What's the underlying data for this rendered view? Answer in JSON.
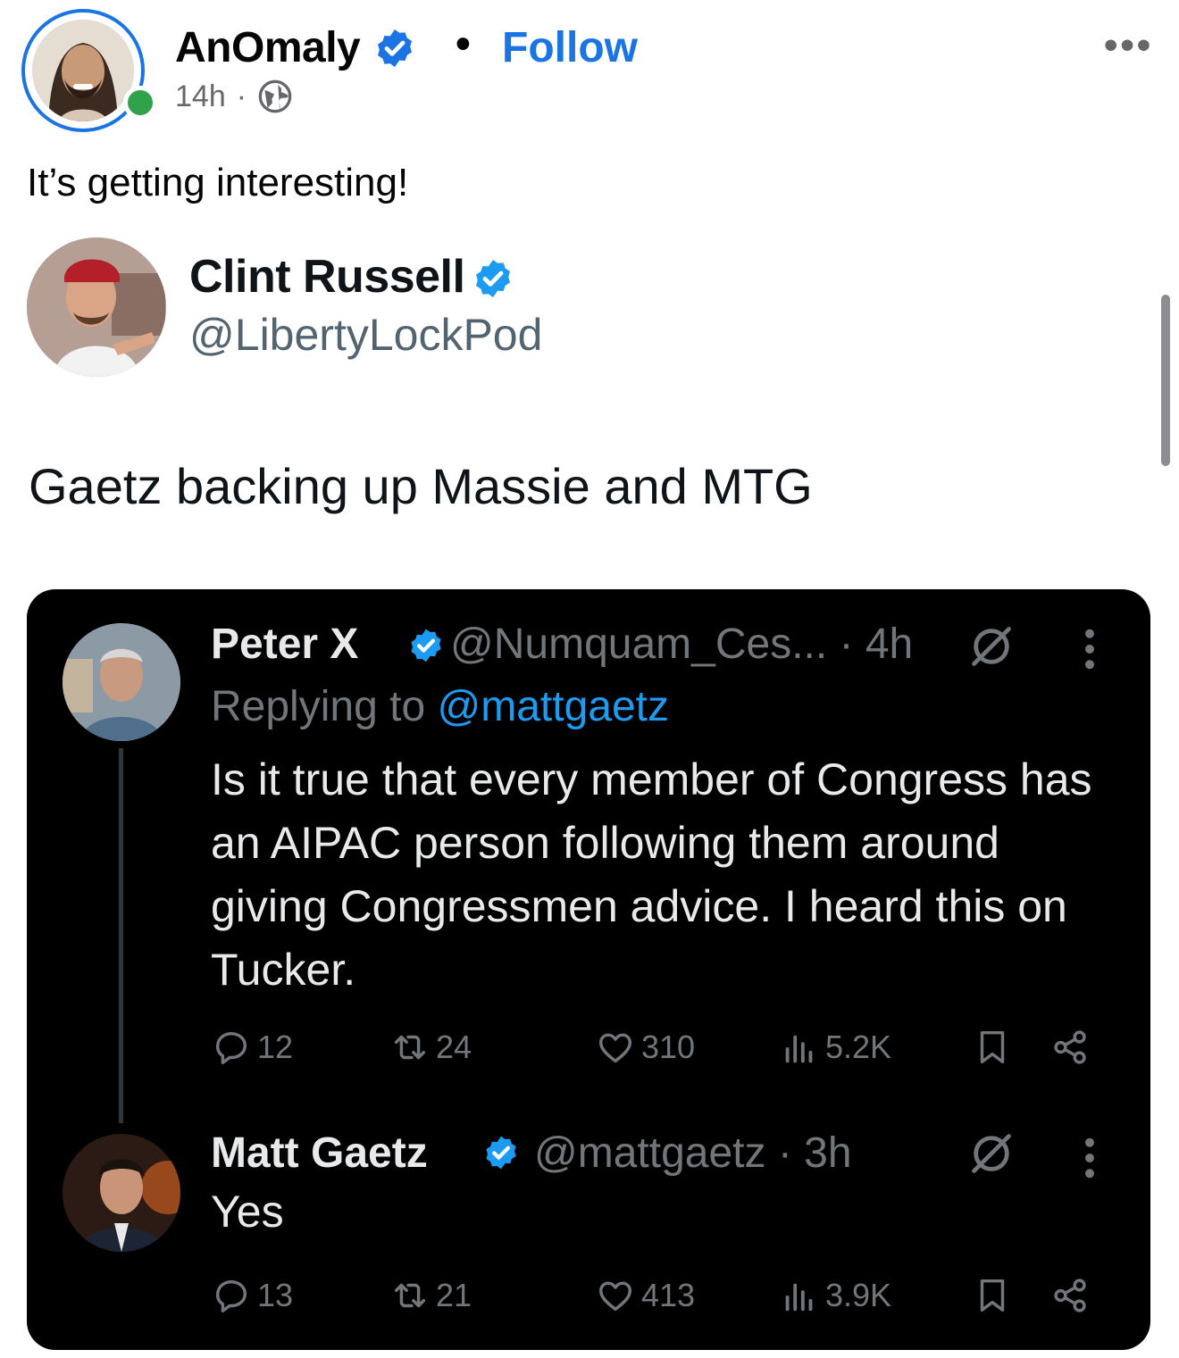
{
  "post": {
    "author_name": "AnOmaly",
    "follow_label": "Follow",
    "separator": "•",
    "more_label": "•••",
    "time": "14h",
    "meta_dot": "·",
    "text": "It’s getting interesting!"
  },
  "shared_tweet": {
    "name": "Clint Russell",
    "handle": "@LibertyLockPod",
    "text": "Gaetz backing up Massie and MTG"
  },
  "thread": {
    "reply": {
      "name": "Peter X",
      "handle_time": "@Numquam_Ces... · 4h",
      "replying_prefix": "Replying to ",
      "replying_mention": "@mattgaetz",
      "text": "Is it true that every member of Congress has an AIPAC person following them around giving Congressmen advice. I heard this on Tucker.",
      "replies": "12",
      "reposts": "24",
      "likes": "310",
      "views": "5.2K"
    },
    "answer": {
      "name": "Matt Gaetz",
      "handle_time": "@mattgaetz · 3h",
      "text": "Yes",
      "replies": "13",
      "reposts": "21",
      "likes": "413",
      "views": "3.9K"
    }
  },
  "colors": {
    "facebook_blue": "#1b74e4",
    "online_green": "#31a24c",
    "x_blue": "#1d9bf0",
    "x_gray": "#71767b",
    "x_text": "#e7e9ea"
  },
  "icons": [
    "verified-badge-icon",
    "globe-icon",
    "grok-icon",
    "more-vertical-icon",
    "reply-icon",
    "repost-icon",
    "like-icon",
    "views-icon",
    "bookmark-icon",
    "share-icon"
  ]
}
